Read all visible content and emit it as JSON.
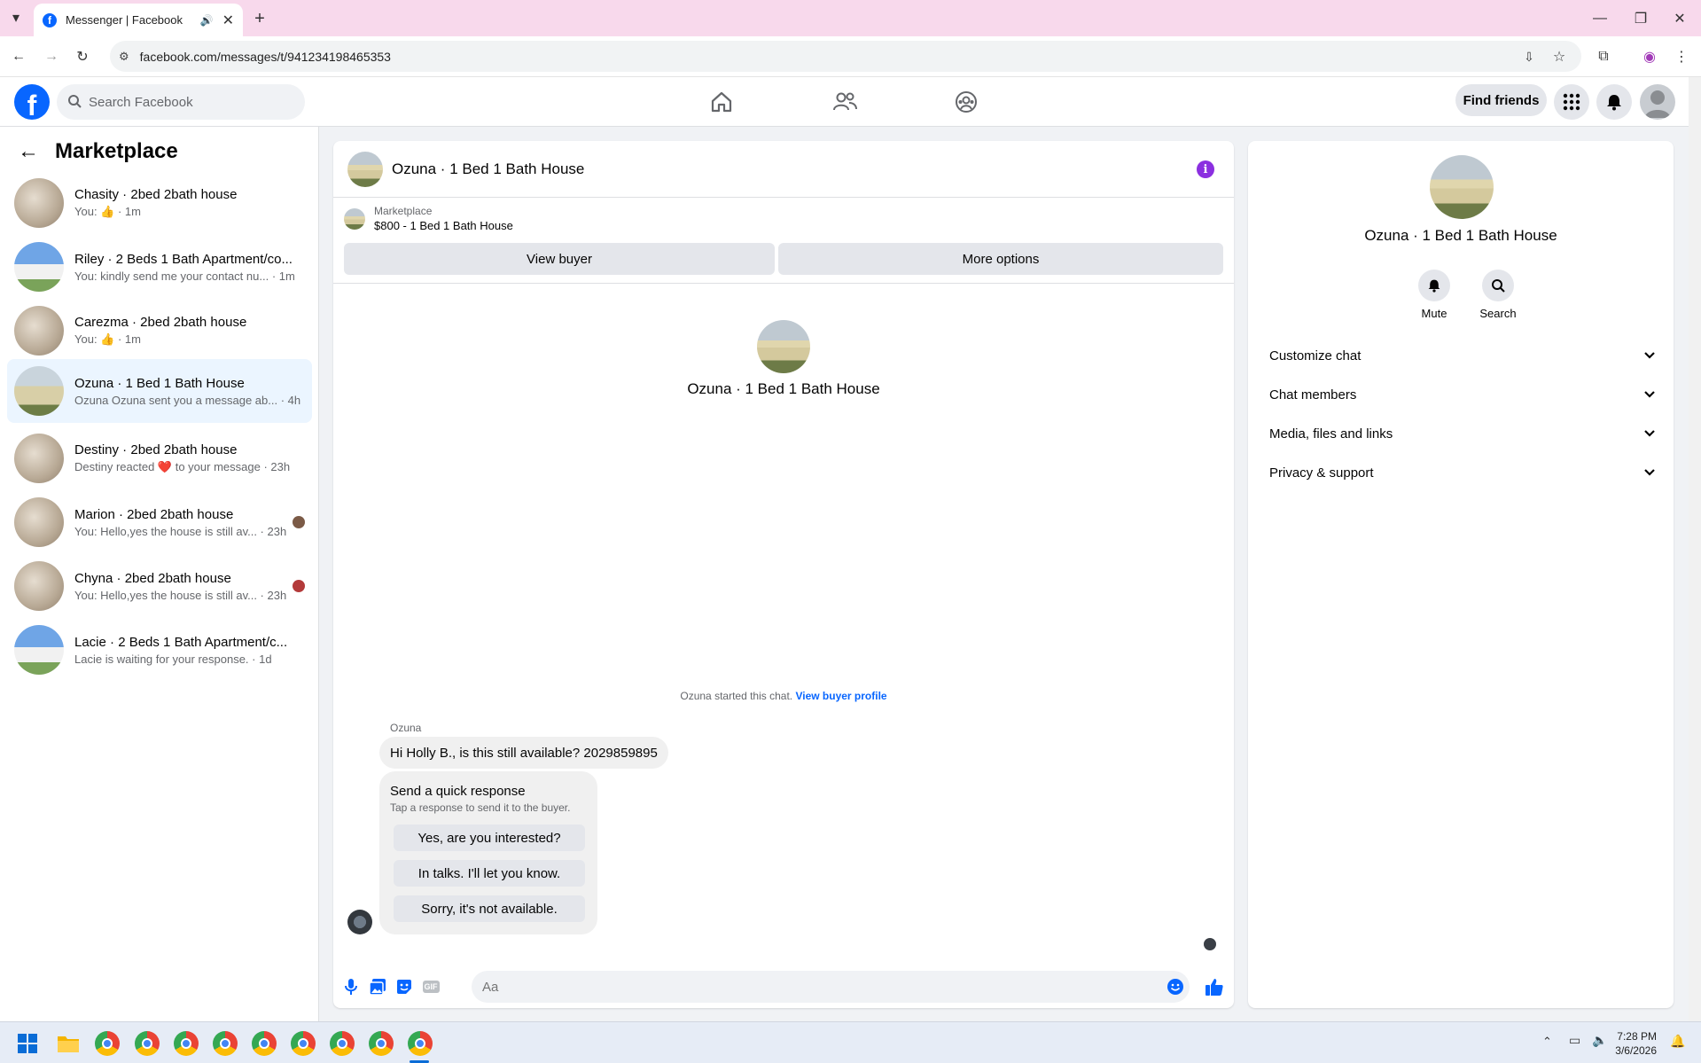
{
  "browser": {
    "tab_title": "Messenger | Facebook",
    "url": "facebook.com/messages/t/941234198465353"
  },
  "header": {
    "search_placeholder": "Search Facebook",
    "find_friends": "Find friends"
  },
  "sidebar": {
    "title": "Marketplace",
    "conversations": [
      {
        "name": "Chasity · 2bed 2bath house",
        "preview": "You: 👍 · 1m",
        "thumb": "room"
      },
      {
        "name": "Riley · 2 Beds 1 Bath Apartment/co...",
        "preview": "You: kindly send me your contact nu... · 1m",
        "thumb": "blue"
      },
      {
        "name": "Carezma · 2bed 2bath house",
        "preview": "You: 👍 · 1m",
        "thumb": "room"
      },
      {
        "name": "Ozuna · 1 Bed 1 Bath House",
        "preview": "Ozuna Ozuna sent you a message ab... · 4h",
        "thumb": "house"
      },
      {
        "name": "Destiny · 2bed 2bath house",
        "preview": "Destiny reacted ❤️ to your message · 23h",
        "thumb": "room"
      },
      {
        "name": "Marion · 2bed 2bath house",
        "preview": "You: Hello,yes the house is still av... · 23h",
        "thumb": "room"
      },
      {
        "name": "Chyna · 2bed 2bath house",
        "preview": "You: Hello,yes the house is still av... · 23h",
        "thumb": "room"
      },
      {
        "name": "Lacie · 2 Beds 1 Bath Apartment/c...",
        "preview": "Lacie is waiting for your response. · 1d",
        "thumb": "blue"
      }
    ]
  },
  "chat": {
    "title": "Ozuna · 1 Bed 1 Bath House",
    "listing_label": "Marketplace",
    "listing_price": "$800 - 1 Bed 1 Bath House",
    "view_buyer": "View buyer",
    "more_options": "More options",
    "intro_name": "Ozuna · 1 Bed 1 Bath House",
    "started_text": "Ozuna started this chat.",
    "view_buyer_profile": "View buyer profile",
    "sender": "Ozuna",
    "message": "Hi Holly B., is this still available? 2029859895",
    "quick_title": "Send a quick response",
    "quick_subtitle": "Tap a response to send it to the buyer.",
    "quick_replies": [
      "Yes, are you interested?",
      "In talks. I'll let you know.",
      "Sorry, it's not available."
    ],
    "input_placeholder": "Aa"
  },
  "details": {
    "name": "Ozuna · 1 Bed 1 Bath House",
    "mute": "Mute",
    "search": "Search",
    "rows": [
      "Customize chat",
      "Chat members",
      "Media, files and links",
      "Privacy & support"
    ]
  },
  "taskbar": {
    "time": "7:28 PM",
    "date": "3/6/2026"
  },
  "colors": {
    "accent": "#0866ff",
    "active_row": "#ebf5ff",
    "info": "#8b2fe0"
  }
}
